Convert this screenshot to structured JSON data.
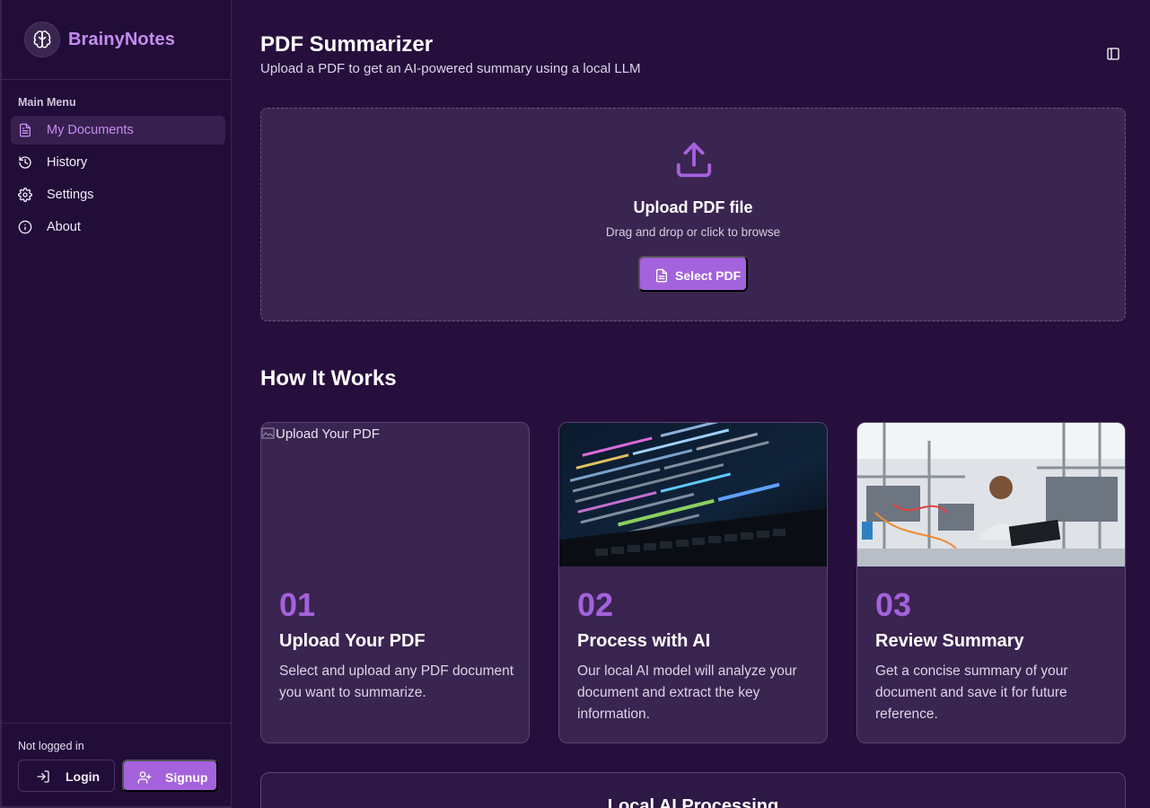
{
  "brand": {
    "name": "BrainyNotes",
    "logo_icon": "brain-icon"
  },
  "sidebar": {
    "heading": "Main Menu",
    "items": [
      {
        "label": "My Documents",
        "icon": "file-icon",
        "active": true
      },
      {
        "label": "History",
        "icon": "history-icon",
        "active": false
      },
      {
        "label": "Settings",
        "icon": "gear-icon",
        "active": false
      },
      {
        "label": "About",
        "icon": "info-icon",
        "active": false
      }
    ],
    "footer": {
      "status": "Not logged in",
      "login_label": "Login",
      "signup_label": "Signup"
    }
  },
  "header": {
    "title": "PDF Summarizer",
    "subtitle": "Upload a PDF to get an AI-powered summary using a local LLM"
  },
  "upload": {
    "title": "Upload PDF file",
    "hint": "Drag and drop or click to browse",
    "button_label": "Select PDF"
  },
  "how_it_works": {
    "title": "How It Works",
    "steps": [
      {
        "number": "01",
        "title": "Upload Your PDF",
        "description": "Select and upload any PDF document you want to summarize.",
        "image_alt": "Upload Your PDF"
      },
      {
        "number": "02",
        "title": "Process with AI",
        "description": "Our local AI model will analyze your document and extract the key information.",
        "image_alt": "Process with AI"
      },
      {
        "number": "03",
        "title": "Review Summary",
        "description": "Get a concise summary of your document and save it for future reference.",
        "image_alt": "Review Summary"
      }
    ]
  },
  "bottom_section": {
    "title": "Local AI Processing"
  },
  "colors": {
    "accent": "#a462dc",
    "background": "#260f3d",
    "sidebar": "#220c38",
    "card": "#3a2450"
  }
}
